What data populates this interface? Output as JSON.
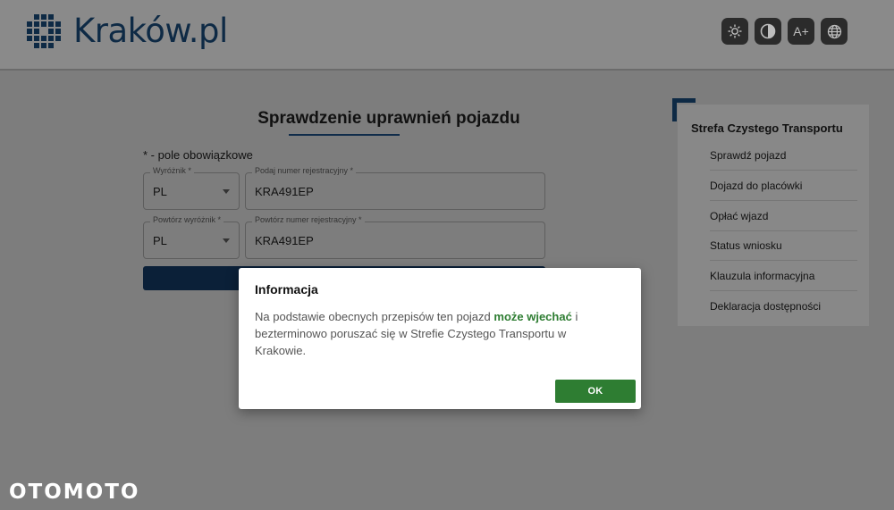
{
  "header": {
    "logo_text": "Kraków.pl",
    "tools": [
      {
        "icon": "brightness-icon",
        "label": ""
      },
      {
        "icon": "contrast-icon",
        "label": ""
      },
      {
        "icon": "font-size-icon",
        "label": "A+"
      },
      {
        "icon": "globe-icon",
        "label": ""
      }
    ]
  },
  "form": {
    "title": "Sprawdzenie uprawnień pojazdu",
    "required_note": "* - pole obowiązkowe",
    "fields": {
      "country": {
        "label": "Wyróżnik *",
        "value": "PL"
      },
      "plate": {
        "label": "Podaj numer rejestracyjny *",
        "value": "KRA491EP"
      },
      "country_repeat": {
        "label": "Powtórz wyróżnik *",
        "value": "PL"
      },
      "plate_repeat": {
        "label": "Powtórz numer rejestracyjny *",
        "value": "KRA491EP"
      }
    }
  },
  "sidebar": {
    "title": "Strefa Czystego Transportu",
    "items": [
      {
        "label": "Sprawdź pojazd"
      },
      {
        "label": "Dojazd do placówki"
      },
      {
        "label": "Opłać wjazd"
      },
      {
        "label": "Status wniosku"
      },
      {
        "label": "Klauzula informacyjna"
      },
      {
        "label": "Deklaracja dostępności"
      }
    ]
  },
  "modal": {
    "title": "Informacja",
    "body_before": "Na podstawie obecnych przepisów ten pojazd ",
    "body_highlight": "może wjechać",
    "body_after": " i bezterminowo poruszać się w Strefie Czystego Transportu w Krakowie.",
    "ok_label": "OK"
  },
  "watermark": "OTOMOTO",
  "colors": {
    "brand_navy": "#0e2a45",
    "success_green": "#2e7d32"
  }
}
